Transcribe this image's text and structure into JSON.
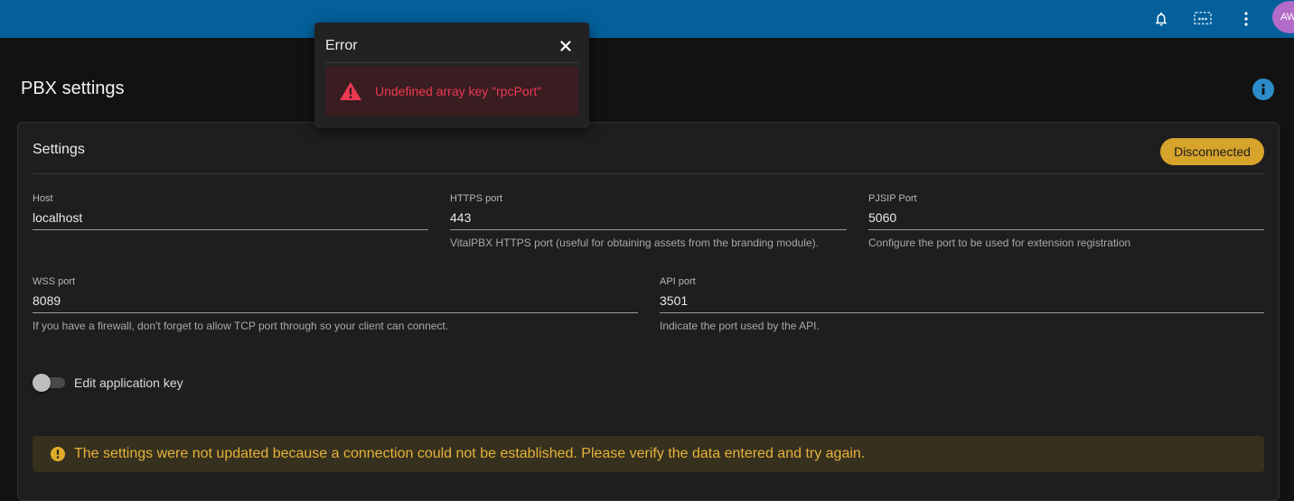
{
  "topbar": {
    "bg_color": "#03609b",
    "icons": [
      "bell-icon",
      "screen-share-icon",
      "more-vert-icon"
    ],
    "avatar_initials": "AW"
  },
  "page": {
    "title": "PBX settings"
  },
  "settings": {
    "title": "Settings",
    "status": "Disconnected",
    "fields": {
      "host": {
        "label": "Host",
        "value": "localhost"
      },
      "https_port": {
        "label": "HTTPS port",
        "value": "443",
        "hint": "VitalPBX HTTPS port (useful for obtaining assets from the branding module)."
      },
      "pjsip_port": {
        "label": "PJSIP Port",
        "value": "5060",
        "hint": "Configure the port to be used for extension registration"
      },
      "wss_port": {
        "label": "WSS port",
        "value": "8089",
        "hint": "If you have a firewall, don't forget to allow TCP port through so your client can connect."
      },
      "api_port": {
        "label": "API port",
        "value": "3501",
        "hint": "Indicate the port used by the API."
      }
    },
    "toggle": {
      "label": "Edit application key",
      "on": false
    },
    "warning": "The settings were not updated because a connection could not be established. Please verify the data entered and try again."
  },
  "error_dialog": {
    "title": "Error",
    "message": "Undefined array key \"rpcPort\""
  },
  "colors": {
    "status_badge": "#d6a32b",
    "warning_text": "#e6b23a",
    "error_text": "#ec3a50",
    "info_icon": "#2c8cc9"
  }
}
